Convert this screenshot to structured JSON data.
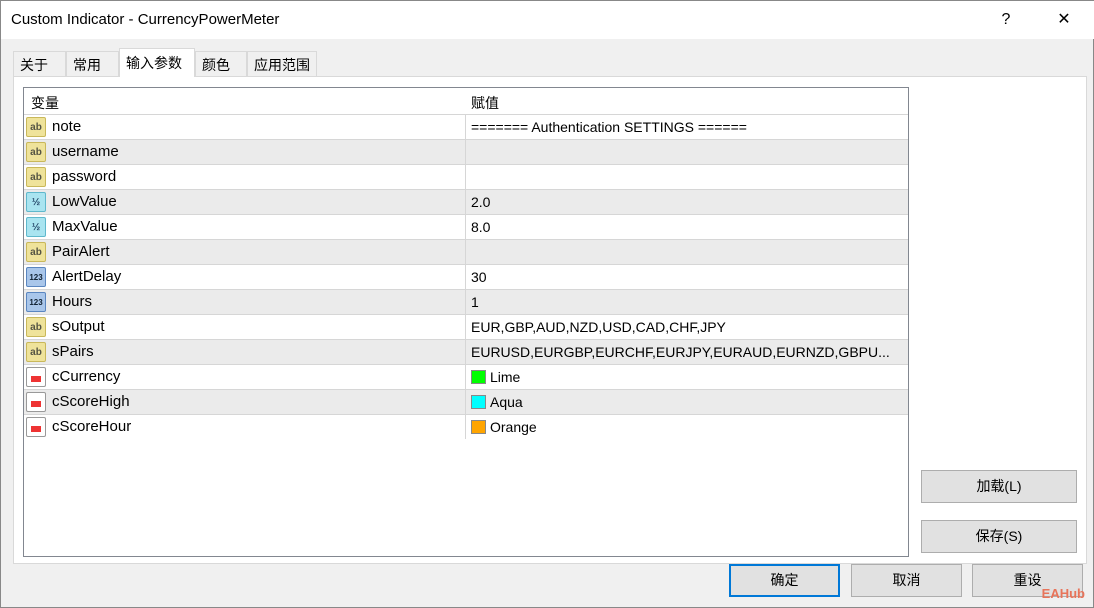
{
  "window": {
    "title": "Custom Indicator - CurrencyPowerMeter",
    "help": "?",
    "close": "✕"
  },
  "tabs": [
    "关于",
    "常用",
    "输入参数",
    "颜色",
    "应用范围"
  ],
  "table": {
    "headers": [
      "变量",
      "赋值"
    ],
    "rows": [
      {
        "icon": "ab",
        "name": "note",
        "value": "======= Authentication SETTINGS ======"
      },
      {
        "icon": "ab",
        "name": "username",
        "value": ""
      },
      {
        "icon": "ab",
        "name": "password",
        "value": ""
      },
      {
        "icon": "dbl",
        "name": "LowValue",
        "value": "2.0"
      },
      {
        "icon": "dbl",
        "name": "MaxValue",
        "value": "8.0"
      },
      {
        "icon": "ab",
        "name": "PairAlert",
        "value": ""
      },
      {
        "icon": "int",
        "name": "AlertDelay",
        "value": "30"
      },
      {
        "icon": "int",
        "name": "Hours",
        "value": "1"
      },
      {
        "icon": "ab",
        "name": "sOutput",
        "value": "EUR,GBP,AUD,NZD,USD,CAD,CHF,JPY"
      },
      {
        "icon": "ab",
        "name": "sPairs",
        "value": "EURUSD,EURGBP,EURCHF,EURJPY,EURAUD,EURNZD,GBPU..."
      },
      {
        "icon": "col",
        "name": "cCurrency",
        "value": "Lime",
        "color": "#00ff00"
      },
      {
        "icon": "col",
        "name": "cScoreHigh",
        "value": "Aqua",
        "color": "#00ffff"
      },
      {
        "icon": "col",
        "name": "cScoreHour",
        "value": "Orange",
        "color": "#ffa500"
      }
    ]
  },
  "buttons": {
    "load": "加载(L)",
    "save": "保存(S)",
    "ok": "确定",
    "cancel": "取消",
    "reset": "重设"
  },
  "watermark": "EAHub"
}
